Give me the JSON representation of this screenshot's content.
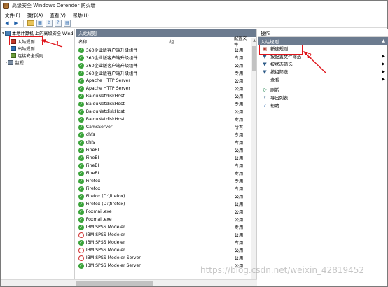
{
  "window": {
    "title": "高级安全 Windows Defender 防火墙"
  },
  "menu": [
    "文件(F)",
    "操作(A)",
    "查看(V)",
    "帮助(H)"
  ],
  "tree": {
    "root": "本地计算机 上的高级安全 Wind",
    "items": [
      "入站规则",
      "出站规则",
      "连接安全规则",
      "监视"
    ]
  },
  "middle": {
    "header": "入站规则",
    "columns": {
      "name": "名称",
      "group": "组",
      "profile": "配置文件"
    },
    "rows": [
      {
        "name": "360企业版客户端升级组件",
        "group": "",
        "profile": "公用",
        "status": "allow"
      },
      {
        "name": "360企业版客户端升级组件",
        "group": "",
        "profile": "专用",
        "status": "allow"
      },
      {
        "name": "360企业版客户端升级组件",
        "group": "",
        "profile": "公用",
        "status": "allow"
      },
      {
        "name": "360企业版客户端升级组件",
        "group": "",
        "profile": "专用",
        "status": "allow"
      },
      {
        "name": "Apache HTTP Server",
        "group": "",
        "profile": "公用",
        "status": "allow"
      },
      {
        "name": "Apache HTTP Server",
        "group": "",
        "profile": "公用",
        "status": "allow"
      },
      {
        "name": "BaiduNetdiskHost",
        "group": "",
        "profile": "公用",
        "status": "allow"
      },
      {
        "name": "BaiduNetdiskHost",
        "group": "",
        "profile": "专用",
        "status": "allow"
      },
      {
        "name": "BaiduNetdiskHost",
        "group": "",
        "profile": "公用",
        "status": "allow"
      },
      {
        "name": "BaiduNetdiskHost",
        "group": "",
        "profile": "专用",
        "status": "allow"
      },
      {
        "name": "CamsServer",
        "group": "",
        "profile": "所有",
        "status": "allow"
      },
      {
        "name": "chfs",
        "group": "",
        "profile": "专用",
        "status": "allow"
      },
      {
        "name": "chfs",
        "group": "",
        "profile": "专用",
        "status": "allow"
      },
      {
        "name": "FineBI",
        "group": "",
        "profile": "公用",
        "status": "allow"
      },
      {
        "name": "FineBI",
        "group": "",
        "profile": "公用",
        "status": "allow"
      },
      {
        "name": "FineBI",
        "group": "",
        "profile": "专用",
        "status": "allow"
      },
      {
        "name": "FineBI",
        "group": "",
        "profile": "专用",
        "status": "allow"
      },
      {
        "name": "Firefox",
        "group": "",
        "profile": "专用",
        "status": "allow"
      },
      {
        "name": "Firefox",
        "group": "",
        "profile": "专用",
        "status": "allow"
      },
      {
        "name": "Firefox (D:\\firefox)",
        "group": "",
        "profile": "公用",
        "status": "allow"
      },
      {
        "name": "Firefox (D:\\firefox)",
        "group": "",
        "profile": "公用",
        "status": "allow"
      },
      {
        "name": "Foxmail.exe",
        "group": "",
        "profile": "公用",
        "status": "allow"
      },
      {
        "name": "Foxmail.exe",
        "group": "",
        "profile": "公用",
        "status": "allow"
      },
      {
        "name": "IBM SPSS Modeler",
        "group": "",
        "profile": "专用",
        "status": "allow"
      },
      {
        "name": "IBM SPSS Modeler",
        "group": "",
        "profile": "公用",
        "status": "block"
      },
      {
        "name": "IBM SPSS Modeler",
        "group": "",
        "profile": "专用",
        "status": "allow"
      },
      {
        "name": "IBM SPSS Modeler",
        "group": "",
        "profile": "公用",
        "status": "block"
      },
      {
        "name": "IBM SPSS Modeler Server",
        "group": "",
        "profile": "公用",
        "status": "block"
      },
      {
        "name": "IBM SPSS Modeler Server",
        "group": "",
        "profile": "公用",
        "status": "allow"
      }
    ]
  },
  "actions": {
    "header": "操作",
    "section": "入站规则",
    "items": [
      {
        "label": "新建规则...",
        "icon": "new-rule-icon",
        "submenu": false
      },
      {
        "label": "按配置文件筛选",
        "icon": "filter-icon",
        "submenu": true
      },
      {
        "label": "按状态筛选",
        "icon": "filter-icon",
        "submenu": true
      },
      {
        "label": "按组筛选",
        "icon": "filter-icon",
        "submenu": true
      },
      {
        "label": "查看",
        "icon": "",
        "submenu": true
      },
      {
        "label": "刷新",
        "icon": "refresh-icon",
        "submenu": false
      },
      {
        "label": "导出列表...",
        "icon": "export-icon",
        "submenu": false
      },
      {
        "label": "帮助",
        "icon": "help-icon",
        "submenu": false
      }
    ]
  },
  "annotations": {
    "one": "1",
    "two": "2"
  },
  "watermark": "https://blog.csdn.net/weixin_42819452",
  "colors": {
    "annotation": "#e0151b",
    "allow": "#3aa33a",
    "block": "#d03030",
    "pane_header": "#6c7b8f"
  }
}
